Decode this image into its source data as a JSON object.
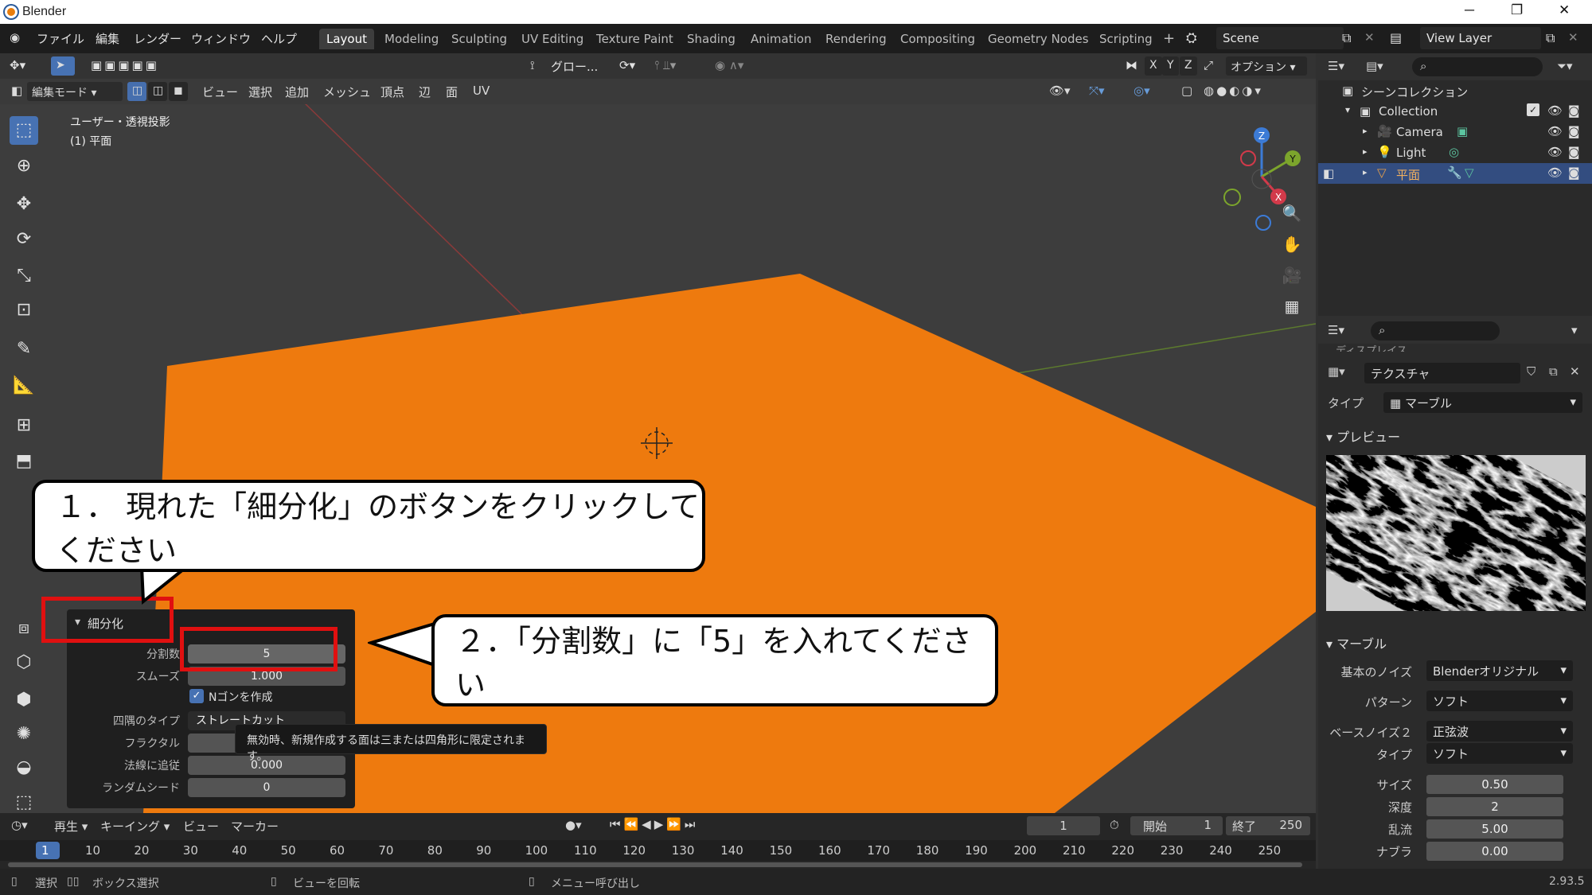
{
  "window": {
    "title": "Blender"
  },
  "topbar": {
    "menus": [
      "ファイル",
      "編集",
      "レンダー",
      "ウィンドウ",
      "ヘルプ"
    ],
    "workspaces": [
      "Layout",
      "Modeling",
      "Sculpting",
      "UV Editing",
      "Texture Paint",
      "Shading",
      "Animation",
      "Rendering",
      "Compositing",
      "Geometry Nodes",
      "Scripting"
    ],
    "active_workspace": "Layout",
    "scene": "Scene",
    "view_layer": "View Layer"
  },
  "viewport": {
    "header": {
      "transform_orientation": "グロー...",
      "options": "オプション",
      "axes": [
        "X",
        "Y",
        "Z"
      ],
      "mode": "編集モード",
      "menus": [
        "ビュー",
        "選択",
        "追加",
        "メッシュ",
        "頂点",
        "辺",
        "面",
        "UV"
      ]
    },
    "overlay_text": {
      "view": "ユーザー・透視投影",
      "object": "(1) 平面"
    },
    "gizmo": {
      "x": "X",
      "y": "Y",
      "z": "Z"
    }
  },
  "operator_panel": {
    "title": "細分化",
    "fields": [
      {
        "label": "分割数",
        "value": "5"
      },
      {
        "label": "スムーズ",
        "value": "1.000"
      },
      {
        "label": "四隅のタイプ",
        "value": "ストレートカット"
      },
      {
        "label": "フラクタル",
        "value": ""
      },
      {
        "label": "法線に追従",
        "value": "0.000"
      },
      {
        "label": "ランダムシード",
        "value": "0"
      }
    ],
    "checkbox": {
      "label": "Nゴンを作成",
      "checked": true
    },
    "tooltip": "無効時、新規作成する面は三または四角形に限定されます。"
  },
  "callouts": {
    "step1": "１．  現れた「細分化」のボタンをクリックしてください",
    "step2": "２．「分割数」に「5」を入れてください"
  },
  "outliner": {
    "root": "シーンコレクション",
    "collection": "Collection",
    "items": [
      "Camera",
      "Light",
      "平面"
    ],
    "selected": "平面"
  },
  "properties": {
    "cutoff_tab": "ディスプレイス",
    "texture_name": "テクスチャ",
    "type_label": "タイプ",
    "type_value": "マーブル",
    "preview_section": "プレビュー",
    "marble_section": "マーブル",
    "rows": [
      {
        "label": "基本のノイズ",
        "value": "Blenderオリジナル"
      },
      {
        "label": "パターン",
        "value": "ソフト"
      },
      {
        "label": "ベースノイズ２",
        "value": "正弦波"
      },
      {
        "label": "タイプ",
        "value": "ソフト"
      }
    ],
    "numbers": [
      {
        "label": "サイズ",
        "value": "0.50"
      },
      {
        "label": "深度",
        "value": "2"
      },
      {
        "label": "乱流",
        "value": "5.00"
      },
      {
        "label": "ナブラ",
        "value": "0.00"
      }
    ]
  },
  "timeline": {
    "menus": [
      "再生",
      "キーイング",
      "ビュー",
      "マーカー"
    ],
    "current_frame": "1",
    "start_label": "開始",
    "start": "1",
    "end_label": "終了",
    "end": "250",
    "ticks": [
      "1",
      "10",
      "20",
      "30",
      "40",
      "50",
      "60",
      "70",
      "80",
      "90",
      "100",
      "110",
      "120",
      "130",
      "140",
      "150",
      "160",
      "170",
      "180",
      "190",
      "200",
      "210",
      "220",
      "230",
      "240",
      "250"
    ]
  },
  "statusbar": {
    "items": [
      "選択",
      "ボックス選択",
      "ビューを回転",
      "メニュー呼び出し"
    ],
    "version": "2.93.5"
  },
  "colors": {
    "accent": "#4772b3",
    "object_orange": "#ee7a0e",
    "header": "#1d1d1d"
  }
}
